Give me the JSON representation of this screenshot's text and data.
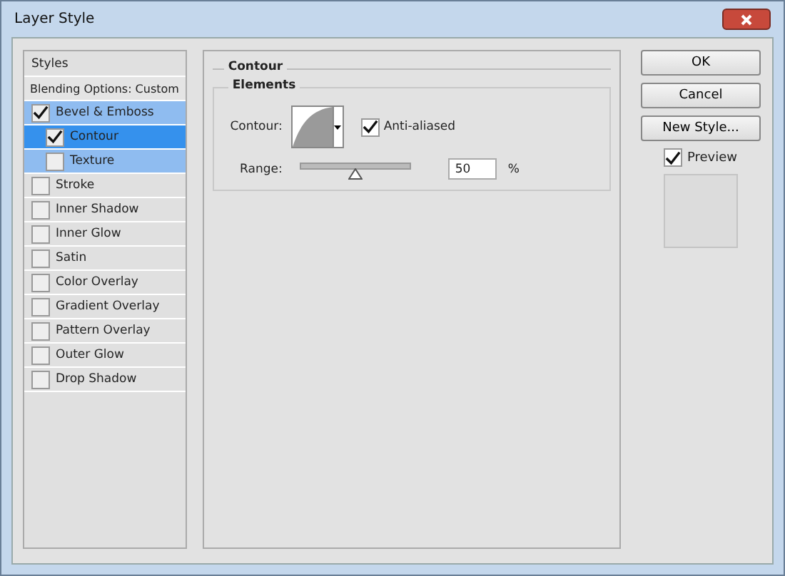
{
  "window": {
    "title": "Layer Style"
  },
  "styles": [
    {
      "kind": "header",
      "label": "Styles"
    },
    {
      "kind": "option",
      "label": "Blending Options: Custom"
    },
    {
      "kind": "effect",
      "label": "Bevel & Emboss",
      "checked": true,
      "selected": false,
      "active": true,
      "children": [
        {
          "kind": "effect",
          "label": "Contour",
          "checked": true,
          "selected": true
        },
        {
          "kind": "effect",
          "label": "Texture",
          "checked": false,
          "selected": false
        }
      ]
    },
    {
      "kind": "effect",
      "label": "Stroke",
      "checked": false,
      "selected": false
    },
    {
      "kind": "effect",
      "label": "Inner Shadow",
      "checked": false,
      "selected": false
    },
    {
      "kind": "effect",
      "label": "Inner Glow",
      "checked": false,
      "selected": false
    },
    {
      "kind": "effect",
      "label": "Satin",
      "checked": false,
      "selected": false
    },
    {
      "kind": "effect",
      "label": "Color Overlay",
      "checked": false,
      "selected": false
    },
    {
      "kind": "effect",
      "label": "Gradient Overlay",
      "checked": false,
      "selected": false
    },
    {
      "kind": "effect",
      "label": "Pattern Overlay",
      "checked": false,
      "selected": false
    },
    {
      "kind": "effect",
      "label": "Outer Glow",
      "checked": false,
      "selected": false
    },
    {
      "kind": "effect",
      "label": "Drop Shadow",
      "checked": false,
      "selected": false
    }
  ],
  "section": {
    "title": "Contour",
    "group": "Elements",
    "contour_label": "Contour:",
    "anti_aliased": {
      "label": "Anti-aliased",
      "checked": true
    },
    "range": {
      "label": "Range:",
      "level": 0.5,
      "value": "50",
      "unit": "%"
    }
  },
  "buttons": [
    "OK",
    "Cancel",
    "New Style..."
  ],
  "preview": {
    "label": "Preview",
    "checked": true
  }
}
